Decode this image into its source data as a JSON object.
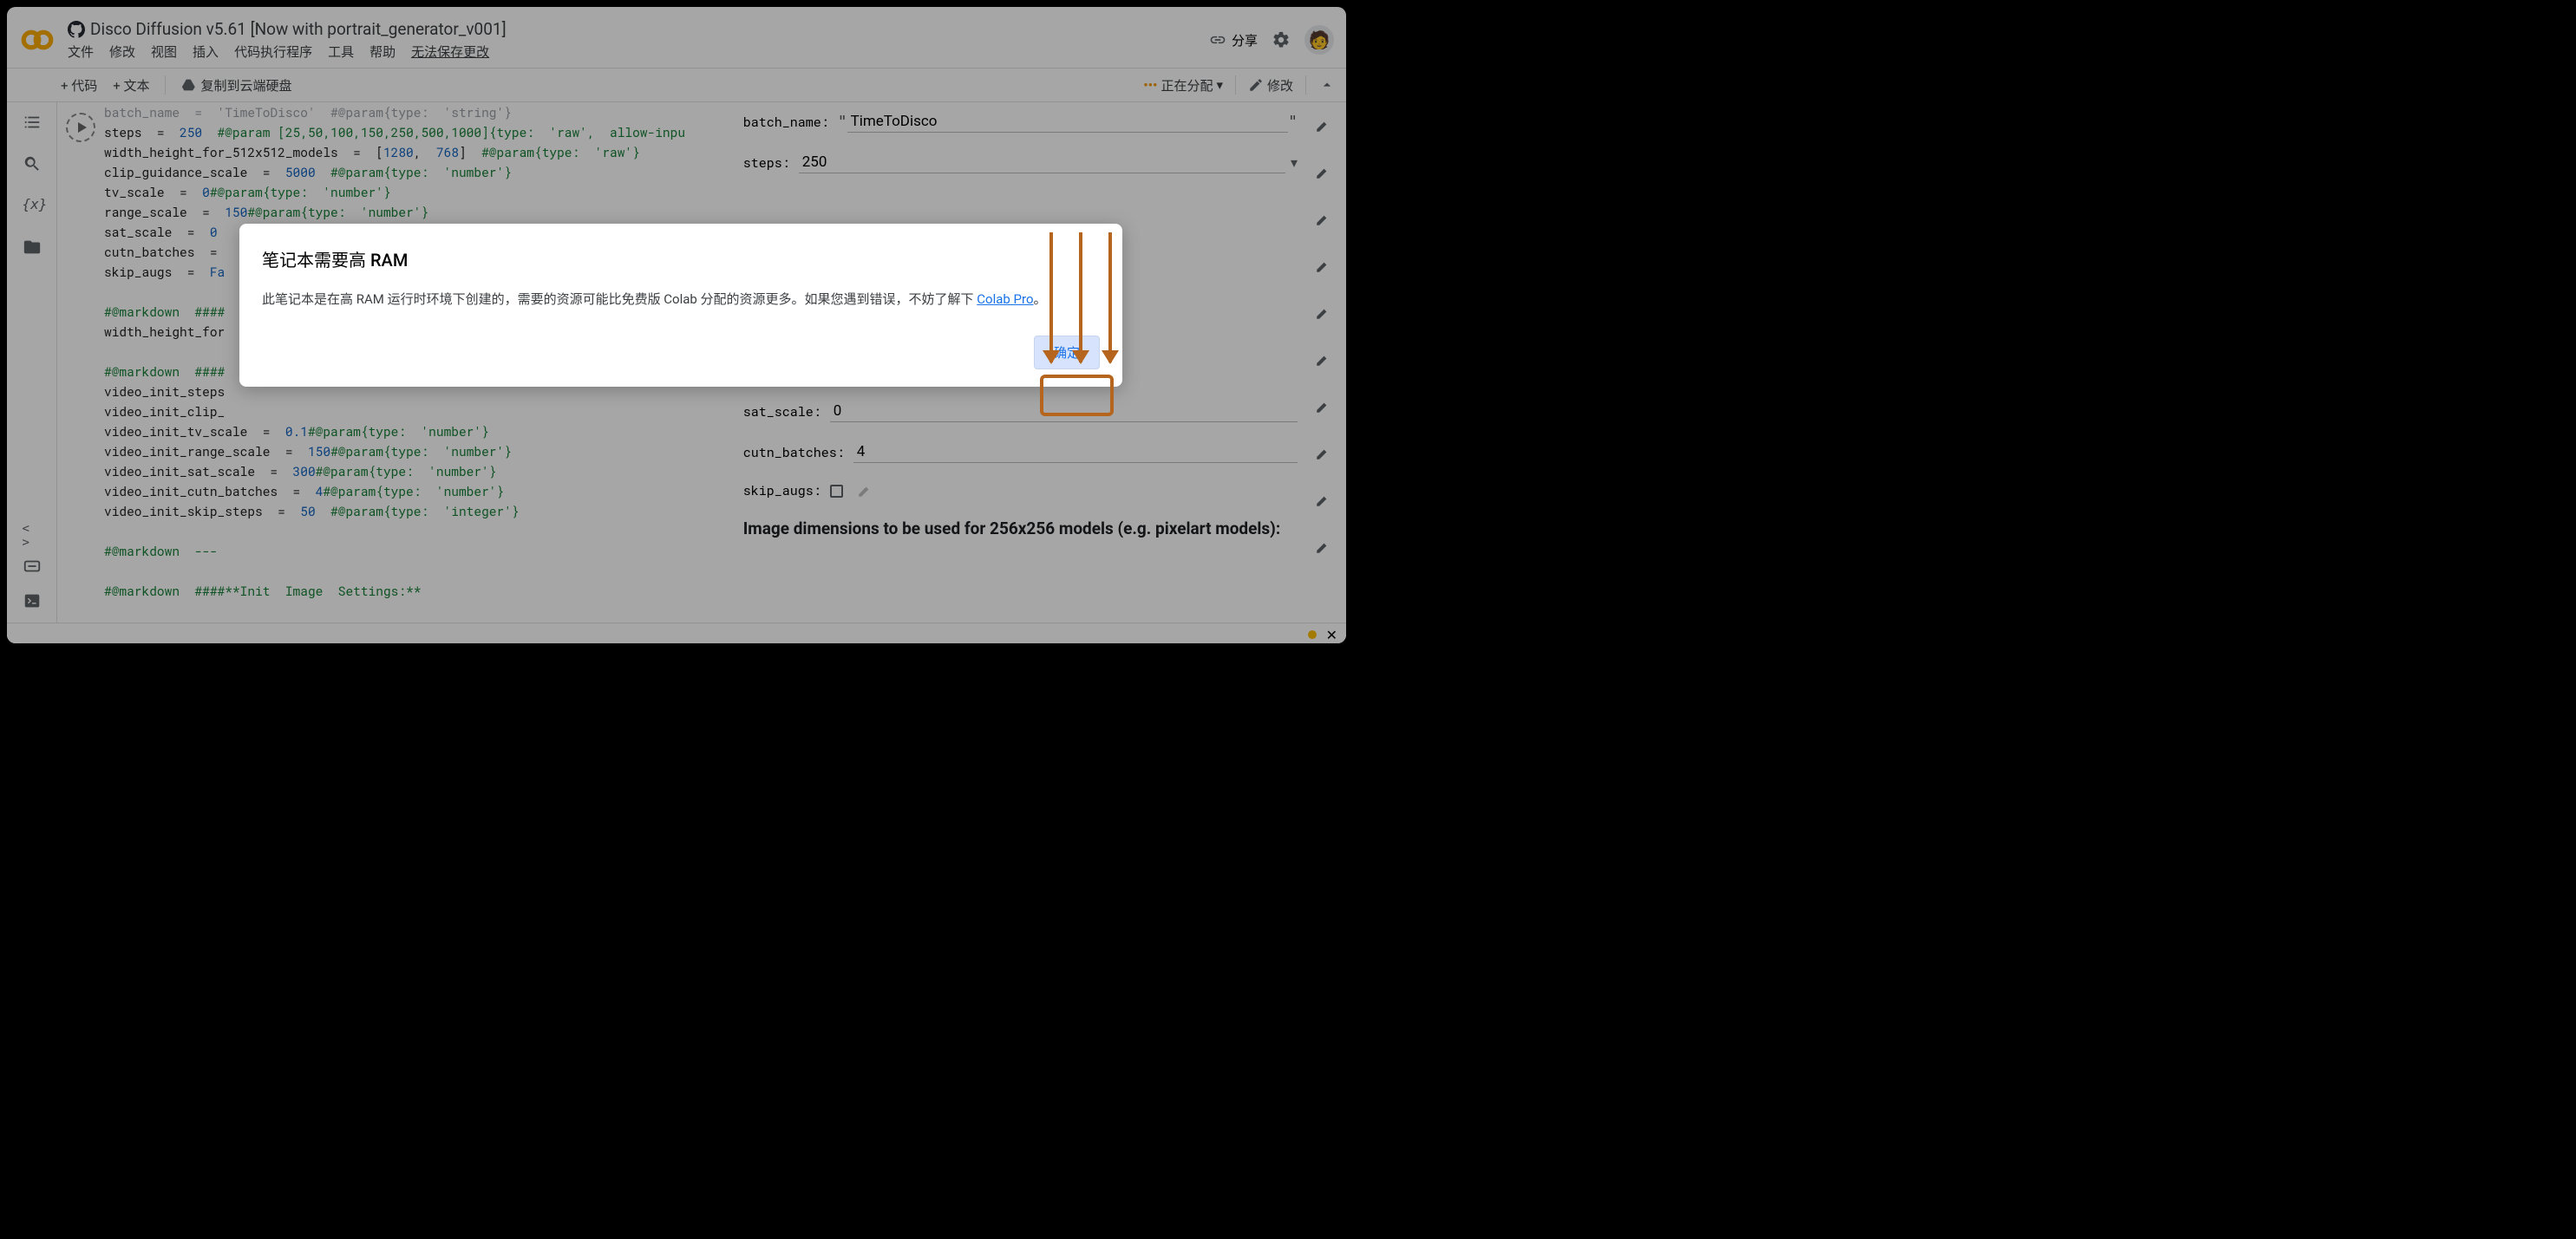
{
  "header": {
    "title": "Disco Diffusion v5.61 [Now with portrait_generator_v001]",
    "share": "分享"
  },
  "menu": {
    "file": "文件",
    "edit": "修改",
    "view": "视图",
    "insert": "插入",
    "runtime": "代码执行程序",
    "tools": "工具",
    "help": "帮助",
    "cannot_save": "无法保存更改"
  },
  "toolbar": {
    "code": "+ 代码",
    "text": "+ 文本",
    "copy_drive": "复制到云端硬盘",
    "allocating": "正在分配",
    "edit": "修改"
  },
  "code": {
    "l0": "batch_name  =  'TimeToDisco'  #@param{type:  'string'}",
    "l1a": "steps  =  ",
    "l1b": "250",
    "l1c": "  #@param [25,50,100,150,250,500,1000]{type:  'raw',  allow-inpu",
    "l2a": "width_height_for_512x512_models  =  [",
    "l2b": "1280",
    "l2c": ",  ",
    "l2d": "768",
    "l2e": "]  ",
    "l2f": "#@param{type:  'raw'}",
    "l3a": "clip_guidance_scale  =  ",
    "l3b": "5000",
    "l3c": "  #@param{type:  'number'}",
    "l4a": "tv_scale  =  ",
    "l4b": "0",
    "l4c": "#@param{type:  'number'}",
    "l5a": "range_scale  =  ",
    "l5b": "150",
    "l5c": "#@param{type:  'number'}",
    "l6a": "sat_scale  =  ",
    "l6b": "0",
    "l7a": "cutn_batches  =  ",
    "l8a": "skip_augs  =  ",
    "l8b": "Fa",
    "l9": "#@markdown  ####",
    "l10": "width_height_for",
    "l11": "#@markdown  ####",
    "l12": "video_init_steps",
    "l13": "video_init_clip_",
    "l14a": "video_init_tv_scale  =  ",
    "l14b": "0.1",
    "l14c": "#@param{type:  'number'}",
    "l15a": "video_init_range_scale  =  ",
    "l15b": "150",
    "l15c": "#@param{type:  'number'}",
    "l16a": "video_init_sat_scale  =  ",
    "l16b": "300",
    "l16c": "#@param{type:  'number'}",
    "l17a": "video_init_cutn_batches  =  ",
    "l17b": "4",
    "l17c": "#@param{type:  'number'}",
    "l18a": "video_init_skip_steps  =  ",
    "l18b": "50",
    "l18c": "  #@param{type:  'integer'}",
    "l19": "#@markdown  ---",
    "l20": "#@markdown  ####**Init  Image  Settings:**"
  },
  "form": {
    "batch_name_label": "batch_name:",
    "batch_name_value": "TimeToDisco",
    "steps_label": "steps:",
    "steps_value": "250",
    "sat_scale_label": "sat_scale:",
    "sat_scale_value": "0",
    "cutn_batches_label": "cutn_batches:",
    "cutn_batches_value": "4",
    "skip_augs_label": "skip_augs:",
    "dim_heading": "Image dimensions to be used for 256x256 models (e.g. pixelart models):"
  },
  "modal": {
    "title": "笔记本需要高 RAM",
    "body": "此笔记本是在高 RAM 运行时环境下创建的，需要的资源可能比免费版 Colab 分配的资源更多。如果您遇到错误，不妨了解下 ",
    "link": "Colab Pro",
    "period": "。",
    "ok": "确定"
  }
}
